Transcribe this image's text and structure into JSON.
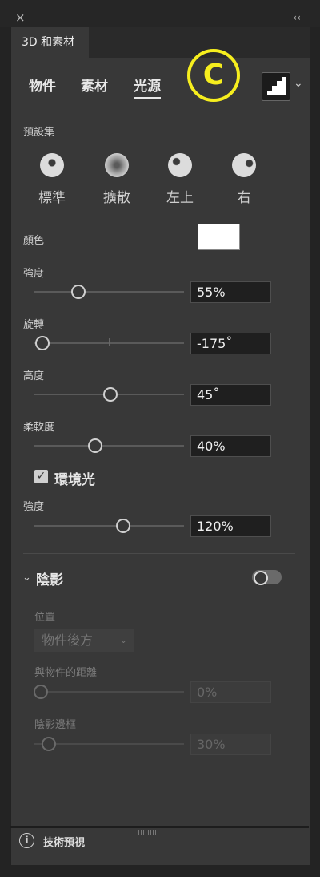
{
  "window": {
    "close_label": "×",
    "collapse_label": "‹‹"
  },
  "panel": {
    "tab_title": "3D 和素材"
  },
  "subtabs": {
    "objects": "物件",
    "materials": "素材",
    "lighting": "光源"
  },
  "annotation": {
    "letter": "C",
    "color": "#f6ee1e"
  },
  "presets": {
    "label": "預設集",
    "items": [
      {
        "label": "標準"
      },
      {
        "label": "擴散"
      },
      {
        "label": "左上"
      },
      {
        "label": "右"
      }
    ]
  },
  "color": {
    "label": "顏色",
    "value": "#ffffff"
  },
  "intensity": {
    "label": "強度",
    "value": "55%",
    "level": 0.55
  },
  "rotation": {
    "label": "旋轉",
    "value": "-175˚"
  },
  "height": {
    "label": "高度",
    "value": "45˚"
  },
  "softness": {
    "label": "柔軟度",
    "value": "40%"
  },
  "ambient": {
    "checkbox_label": "環境光",
    "checked": true,
    "intensity_label": "強度",
    "intensity_value": "120%"
  },
  "shadow": {
    "label": "陰影",
    "enabled": false,
    "position_label": "位置",
    "position_value": "物件後方",
    "distance_label": "與物件的距離",
    "distance_value": "0%",
    "bound_label": "陰影邊框",
    "bound_value": "30%"
  },
  "footer": {
    "tech_preview": "技術預視"
  }
}
